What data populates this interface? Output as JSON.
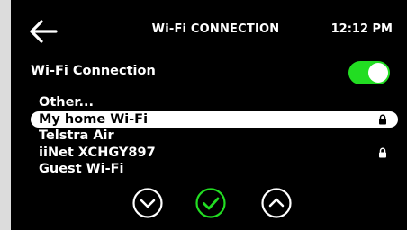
{
  "header": {
    "title": "Wi-Fi CONNECTION",
    "time": "12:12 PM"
  },
  "wifi": {
    "label": "Wi-Fi Connection",
    "enabled": true,
    "toggle_color": "#22dd22"
  },
  "networks": [
    {
      "name": "Other...",
      "locked": false,
      "selected": false
    },
    {
      "name": "My home Wi-Fi",
      "locked": true,
      "selected": true
    },
    {
      "name": "Telstra Air",
      "locked": false,
      "selected": false
    },
    {
      "name": "iiNet XCHGY897",
      "locked": true,
      "selected": false
    },
    {
      "name": "Guest Wi-Fi",
      "locked": false,
      "selected": false
    }
  ],
  "icons": {
    "back": "arrow-left-icon",
    "down": "chevron-down-circle-icon",
    "confirm": "check-circle-icon",
    "up": "chevron-up-circle-icon",
    "lock": "lock-icon"
  },
  "colors": {
    "background": "#000000",
    "accent": "#22dd22",
    "text": "#ffffff"
  }
}
